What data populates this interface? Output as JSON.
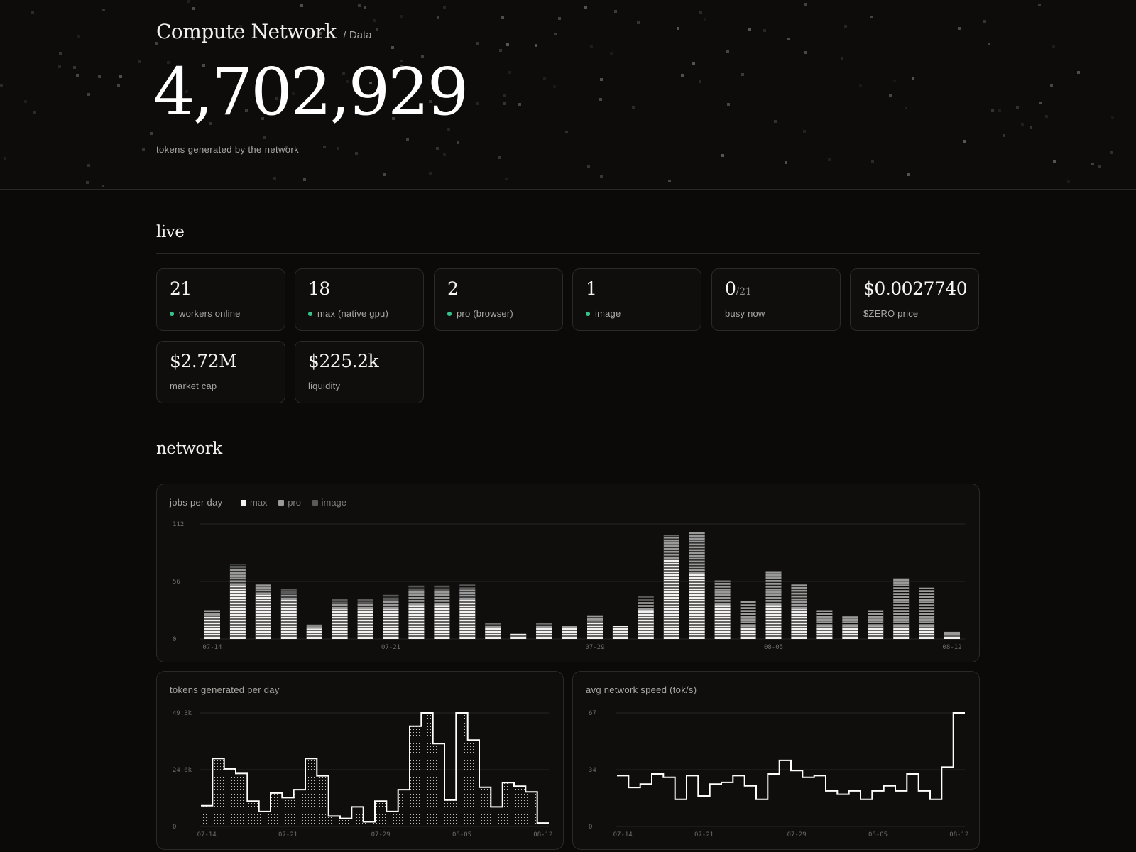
{
  "header": {
    "title": "Compute Network",
    "subtitle": "/ Data",
    "token_count": "4,702,929",
    "caption": "tokens generated by the network"
  },
  "live": {
    "section_title": "live",
    "cards": [
      {
        "value": "21",
        "label": "workers online",
        "indicator": "green-dot"
      },
      {
        "value": "18",
        "label": "max (native gpu)",
        "indicator": "green-dot"
      },
      {
        "value": "2",
        "label": "pro (browser)",
        "indicator": "green-dot"
      },
      {
        "value": "1",
        "label": "image",
        "indicator": "green-dot"
      },
      {
        "value": "0",
        "value_suffix": "/21",
        "label": "busy now"
      },
      {
        "value": "$0.0027740",
        "label": "$ZERO price"
      },
      {
        "value": "$2.72M",
        "label": "market cap"
      },
      {
        "value": "$225.2k",
        "label": "liquidity"
      }
    ],
    "indicator_color": "#34c48b"
  },
  "network": {
    "section_title": "network"
  },
  "chart_data": [
    {
      "type": "bar",
      "stacked": true,
      "title": "jobs per day",
      "legend": [
        "max",
        "pro",
        "image"
      ],
      "legend_placement": "top-left",
      "colors": {
        "max": "#f2f2f2",
        "pro": "#9a9a9a",
        "image": "#595959"
      },
      "ylim": [
        0,
        112
      ],
      "yticks": [
        "112",
        "56",
        "0"
      ],
      "xtick_labels": [
        "07-14",
        "07-21",
        "07-29",
        "08-05",
        "08-12"
      ],
      "grid": true,
      "categories": [
        "07-14",
        "07-15",
        "07-16",
        "07-17",
        "07-18",
        "07-19",
        "07-20",
        "07-21",
        "07-22",
        "07-23",
        "07-24",
        "07-25",
        "07-26",
        "07-27",
        "07-28",
        "07-29",
        "07-30",
        "07-31",
        "08-01",
        "08-02",
        "08-03",
        "08-04",
        "08-05",
        "08-06",
        "08-07",
        "08-08",
        "08-09",
        "08-10",
        "08-11",
        "08-12"
      ],
      "series": [
        {
          "name": "max",
          "values": [
            23,
            52,
            43,
            38,
            10,
            29,
            29,
            29,
            33,
            33,
            38,
            11,
            5,
            11,
            11,
            18,
            13,
            28,
            78,
            63,
            33,
            12,
            33,
            29,
            12,
            12,
            12,
            12,
            12,
            4
          ]
        },
        {
          "name": "pro",
          "values": [
            5,
            17,
            10,
            6,
            4,
            5,
            5,
            9,
            14,
            14,
            10,
            4,
            0,
            4,
            2,
            5,
            0,
            9,
            23,
            41,
            24,
            25,
            33,
            24,
            16,
            10,
            16,
            47,
            38,
            3
          ]
        },
        {
          "name": "image",
          "values": [
            0,
            4,
            0,
            5,
            0,
            5,
            5,
            5,
            5,
            5,
            5,
            0,
            0,
            0,
            0,
            0,
            0,
            5,
            0,
            0,
            0,
            0,
            0,
            0,
            0,
            0,
            0,
            0,
            0,
            0
          ]
        }
      ]
    },
    {
      "type": "area",
      "step": true,
      "title": "tokens generated per day",
      "ylim": [
        0,
        49300
      ],
      "yticks": [
        "49.3k",
        "24.6k",
        "0"
      ],
      "xtick_labels": [
        "07-14",
        "07-21",
        "07-29",
        "08-05",
        "08-12"
      ],
      "grid": true,
      "x": [
        "07-14",
        "07-15",
        "07-16",
        "07-17",
        "07-18",
        "07-19",
        "07-20",
        "07-21",
        "07-22",
        "07-23",
        "07-24",
        "07-25",
        "07-26",
        "07-27",
        "07-28",
        "07-29",
        "07-30",
        "07-31",
        "08-01",
        "08-02",
        "08-03",
        "08-04",
        "08-05",
        "08-06",
        "08-07",
        "08-08",
        "08-09",
        "08-10",
        "08-11",
        "08-12"
      ],
      "values": [
        9000,
        29500,
        25000,
        23000,
        11000,
        6500,
        14500,
        12500,
        16000,
        29500,
        22000,
        4500,
        3500,
        8500,
        2000,
        11000,
        6500,
        16000,
        43500,
        49300,
        36000,
        11500,
        49300,
        37500,
        17000,
        8500,
        19000,
        17500,
        15000,
        1500
      ]
    },
    {
      "type": "line",
      "step": true,
      "title": "avg network speed (tok/s)",
      "ylim": [
        0,
        67
      ],
      "yticks": [
        "67",
        "34",
        "0"
      ],
      "xtick_labels": [
        "07-14",
        "07-21",
        "07-29",
        "08-05",
        "08-12"
      ],
      "grid": true,
      "x": [
        "07-14",
        "07-15",
        "07-16",
        "07-17",
        "07-18",
        "07-19",
        "07-20",
        "07-21",
        "07-22",
        "07-23",
        "07-24",
        "07-25",
        "07-26",
        "07-27",
        "07-28",
        "07-29",
        "07-30",
        "07-31",
        "08-01",
        "08-02",
        "08-03",
        "08-04",
        "08-05",
        "08-06",
        "08-07",
        "08-08",
        "08-09",
        "08-10",
        "08-11",
        "08-12"
      ],
      "values": [
        30,
        23,
        25,
        31,
        29,
        16,
        30,
        18,
        25,
        26,
        30,
        24,
        16,
        31,
        39,
        33,
        29,
        30,
        21,
        19,
        21,
        16,
        21,
        24,
        21,
        31,
        21,
        16,
        35,
        67
      ]
    }
  ]
}
